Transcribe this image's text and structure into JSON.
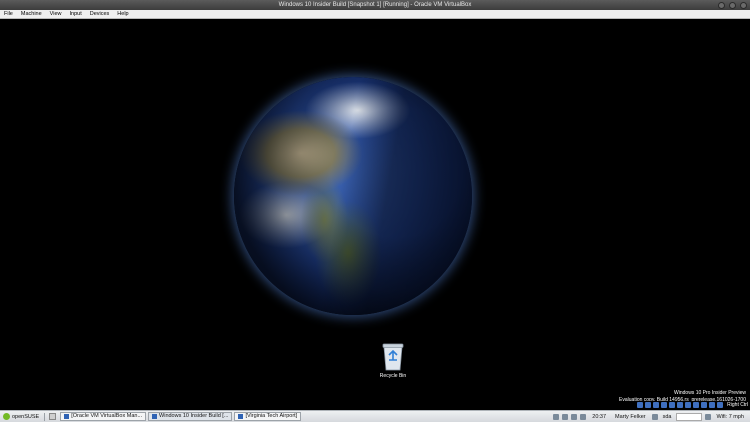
{
  "window": {
    "title": "Windows 10 Insider Build [Snapshot 1] [Running] - Oracle VM VirtualBox"
  },
  "menu": {
    "items": [
      "File",
      "Machine",
      "View",
      "Input",
      "Devices",
      "Help"
    ]
  },
  "desktop": {
    "recycle_bin_label": "Recycle Bin",
    "watermark_line1": "Windows 10 Pro Insider Preview",
    "watermark_line2": "Evaluation copy. Build 14956.rs_prerelease.161026-1700"
  },
  "vm_tray": {
    "host_key": "Right Ctrl"
  },
  "host_taskbar": {
    "start_label": "openSUSE",
    "tasks": [
      "[Oracle VM VirtualBox Man...",
      "Windows 10 Insider Build [...",
      "[Virginia Tech Airport]"
    ],
    "clock": "20:37",
    "user": "Marty Felker",
    "drive": "sda",
    "wifi": "Wifi: 7 mph"
  },
  "colors": {
    "accent_start": "#73ba25",
    "taskbar_bg": "#e3e6e9"
  }
}
